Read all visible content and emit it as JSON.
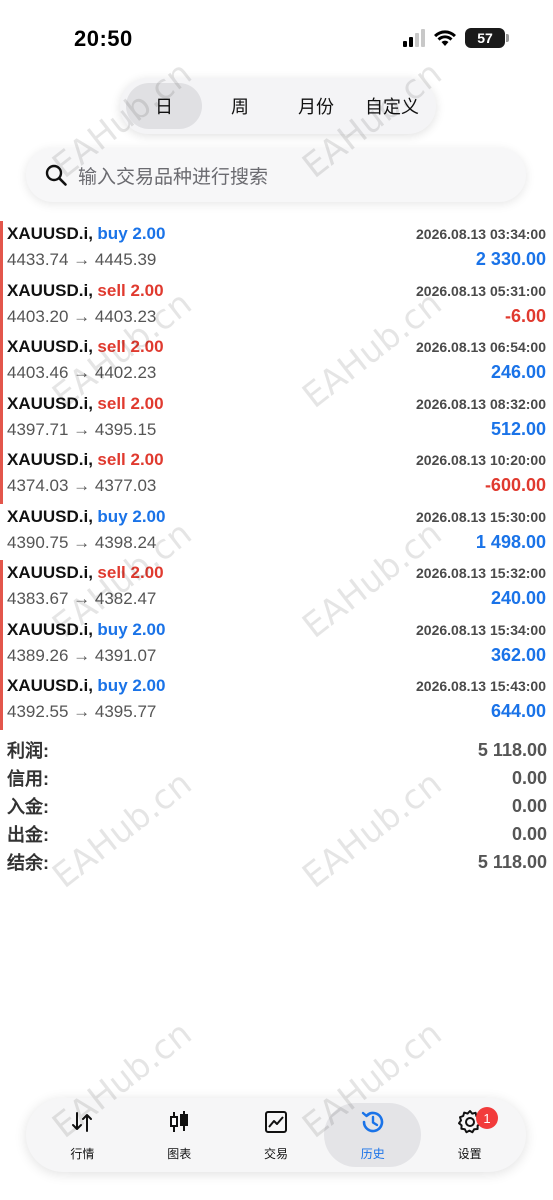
{
  "status_bar": {
    "time": "20:50",
    "battery": "57"
  },
  "period_tabs": [
    {
      "label": "日",
      "active": true
    },
    {
      "label": "周",
      "active": false
    },
    {
      "label": "月份",
      "active": false
    },
    {
      "label": "自定义",
      "active": false
    }
  ],
  "search": {
    "placeholder": "输入交易品种进行搜索"
  },
  "trades": [
    {
      "symbol": "XAUUSD.i,",
      "direction": "buy 2.00",
      "side": "buy",
      "time": "2026.08.13 03:34:00",
      "prices": "4433.74 → 4445.39",
      "profit": "2 330.00",
      "sign": "pos",
      "marker": true
    },
    {
      "symbol": "XAUUSD.i,",
      "direction": "sell 2.00",
      "side": "sell",
      "time": "2026.08.13 05:31:00",
      "prices": "4403.20 → 4403.23",
      "profit": "-6.00",
      "sign": "neg",
      "marker": true
    },
    {
      "symbol": "XAUUSD.i,",
      "direction": "sell 2.00",
      "side": "sell",
      "time": "2026.08.13 06:54:00",
      "prices": "4403.46 → 4402.23",
      "profit": "246.00",
      "sign": "pos",
      "marker": true
    },
    {
      "symbol": "XAUUSD.i,",
      "direction": "sell 2.00",
      "side": "sell",
      "time": "2026.08.13 08:32:00",
      "prices": "4397.71 → 4395.15",
      "profit": "512.00",
      "sign": "pos",
      "marker": true
    },
    {
      "symbol": "XAUUSD.i,",
      "direction": "sell 2.00",
      "side": "sell",
      "time": "2026.08.13 10:20:00",
      "prices": "4374.03 → 4377.03",
      "profit": "-600.00",
      "sign": "neg",
      "marker": true
    },
    {
      "symbol": "XAUUSD.i,",
      "direction": "buy 2.00",
      "side": "buy",
      "time": "2026.08.13 15:30:00",
      "prices": "4390.75 → 4398.24",
      "profit": "1 498.00",
      "sign": "pos",
      "marker": false
    },
    {
      "symbol": "XAUUSD.i,",
      "direction": "sell 2.00",
      "side": "sell",
      "time": "2026.08.13 15:32:00",
      "prices": "4383.67 → 4382.47",
      "profit": "240.00",
      "sign": "pos",
      "marker": true
    },
    {
      "symbol": "XAUUSD.i,",
      "direction": "buy 2.00",
      "side": "buy",
      "time": "2026.08.13 15:34:00",
      "prices": "4389.26 → 4391.07",
      "profit": "362.00",
      "sign": "pos",
      "marker": true
    },
    {
      "symbol": "XAUUSD.i,",
      "direction": "buy 2.00",
      "side": "buy",
      "time": "2026.08.13 15:43:00",
      "prices": "4392.55 → 4395.77",
      "profit": "644.00",
      "sign": "pos",
      "marker": true
    }
  ],
  "summary": [
    {
      "label": "利润:",
      "value": "5 118.00"
    },
    {
      "label": "信用:",
      "value": "0.00"
    },
    {
      "label": "入金:",
      "value": "0.00"
    },
    {
      "label": "出金:",
      "value": "0.00"
    },
    {
      "label": "结余:",
      "value": "5 118.00"
    }
  ],
  "bottom_tabs": [
    {
      "label": "行情",
      "icon": "quotes-icon",
      "active": false
    },
    {
      "label": "图表",
      "icon": "chart-icon",
      "active": false
    },
    {
      "label": "交易",
      "icon": "trade-icon",
      "active": false
    },
    {
      "label": "历史",
      "icon": "history-icon",
      "active": true
    },
    {
      "label": "设置",
      "icon": "settings-icon",
      "active": false,
      "badge": "1"
    }
  ],
  "watermark": "EAHub.cn",
  "colors": {
    "buy": "#1a73e8",
    "sell": "#e03a2f",
    "marker": "#e3564b",
    "badge": "#f23b3b"
  }
}
